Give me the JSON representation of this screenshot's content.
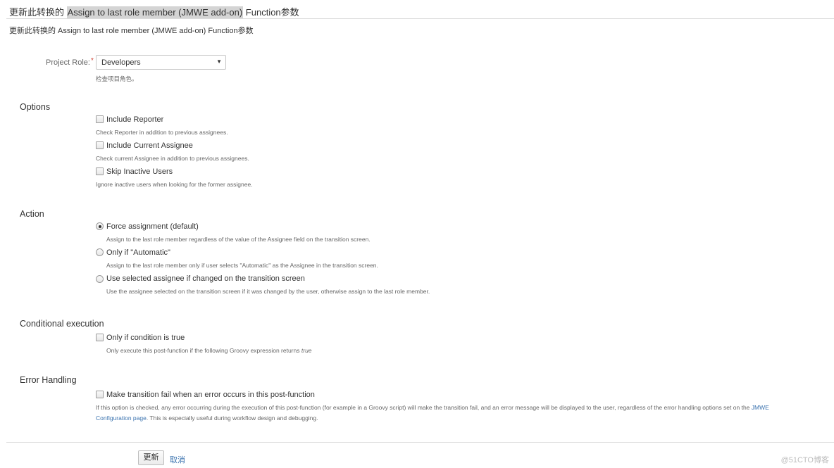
{
  "header": {
    "title_prefix": "更新此转换的",
    "title_highlight": "Assign to last role member (JMWE add-on)",
    "title_suffix": "Function参数",
    "subtitle": "更新此转换的 Assign to last role member (JMWE add-on) Function参数"
  },
  "project_role": {
    "label": "Project Role:",
    "required_mark": "*",
    "selected": "Developers",
    "hint": "检查项目角色。"
  },
  "options": {
    "heading": "Options",
    "items": [
      {
        "label": "Include Reporter",
        "hint": "Check Reporter in addition to previous assignees.",
        "checked": false
      },
      {
        "label": "Include Current Assignee",
        "hint": "Check current Assignee in addition to previous assignees.",
        "checked": false
      },
      {
        "label": "Skip Inactive Users",
        "hint": "Ignore inactive users when looking for the former assignee.",
        "checked": false
      }
    ]
  },
  "action": {
    "heading": "Action",
    "items": [
      {
        "label": "Force assignment (default)",
        "hint": "Assign to the last role member regardless of the value of the Assignee field on the transition screen.",
        "selected": true
      },
      {
        "label": "Only if \"Automatic\"",
        "hint": "Assign to the last role member only if user selects \"Automatic\" as the Assignee in the transition screen.",
        "selected": false
      },
      {
        "label": "Use selected assignee if changed on the transition screen",
        "hint": "Use the assignee selected on the transition screen if it was changed by the user, otherwise assign to the last role member.",
        "selected": false
      }
    ]
  },
  "conditional": {
    "heading": "Conditional execution",
    "label": "Only if condition is true",
    "hint": "Only execute this post-function if the following Groovy expression returns",
    "hint_em": "true",
    "checked": false
  },
  "error_handling": {
    "heading": "Error Handling",
    "label": "Make transition fail when an error occurs in this post-function",
    "hint_line1": "If this option is checked, any error occurring during the execution of this post-function (for example in a Groovy script) will make the transition fail, and an error message will be displayed to the user, regardless of the error handling options set on the",
    "link1": "JMWE",
    "link2": "Configuration page",
    "hint_line2_rest": ". This is especially useful during workflow design and debugging.",
    "checked": false
  },
  "footer": {
    "update_label": "更新",
    "cancel_label": "取消",
    "watermark": "@51CTO博客"
  }
}
